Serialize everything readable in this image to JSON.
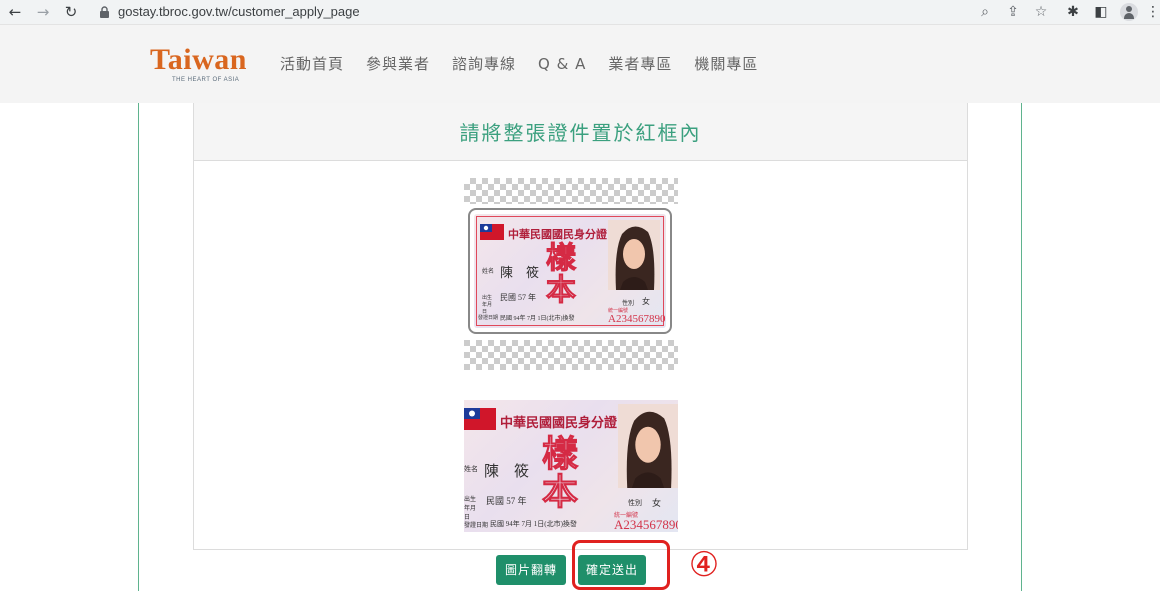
{
  "browser": {
    "url": "gostay.tbroc.gov.tw/customer_apply_page",
    "icons": [
      "back-icon",
      "forward-icon",
      "reload-icon",
      "lock-icon",
      "zoom-icon",
      "share-icon",
      "star-icon",
      "extensions-icon",
      "sidebar-icon",
      "profile-icon",
      "menu-icon"
    ]
  },
  "header": {
    "logo_text": "Taiwan",
    "logo_subtitle": "THE HEART OF ASIA",
    "nav": [
      "活動首頁",
      "參與業者",
      "諮詢專線",
      "Q & A",
      "業者專區",
      "機關專區"
    ]
  },
  "panel": {
    "title": "請將整張證件置於紅框內"
  },
  "id_card": {
    "title": "中華民國國民身分證",
    "stamp_line1": "樣",
    "stamp_line2": "本",
    "name_label": "姓名",
    "name_value": "陳　筱",
    "birth_label": "出生年月日",
    "birth_value": "民國 57 年",
    "sex_label": "性別",
    "sex_value": "女",
    "issue_label": "發證日期",
    "issue_value": "民國 94年 7月 1日(北市)換發",
    "id_label": "統一編號",
    "id_number": "A234567890"
  },
  "buttons": {
    "flip": "圖片翻轉",
    "submit": "確定送出"
  },
  "annotation": {
    "step_marker": "④",
    "color": "#e0211f"
  },
  "colors": {
    "brand_green": "#1f8f6a",
    "title_green": "#3ba07f",
    "logo_orange": "#d9661f"
  }
}
